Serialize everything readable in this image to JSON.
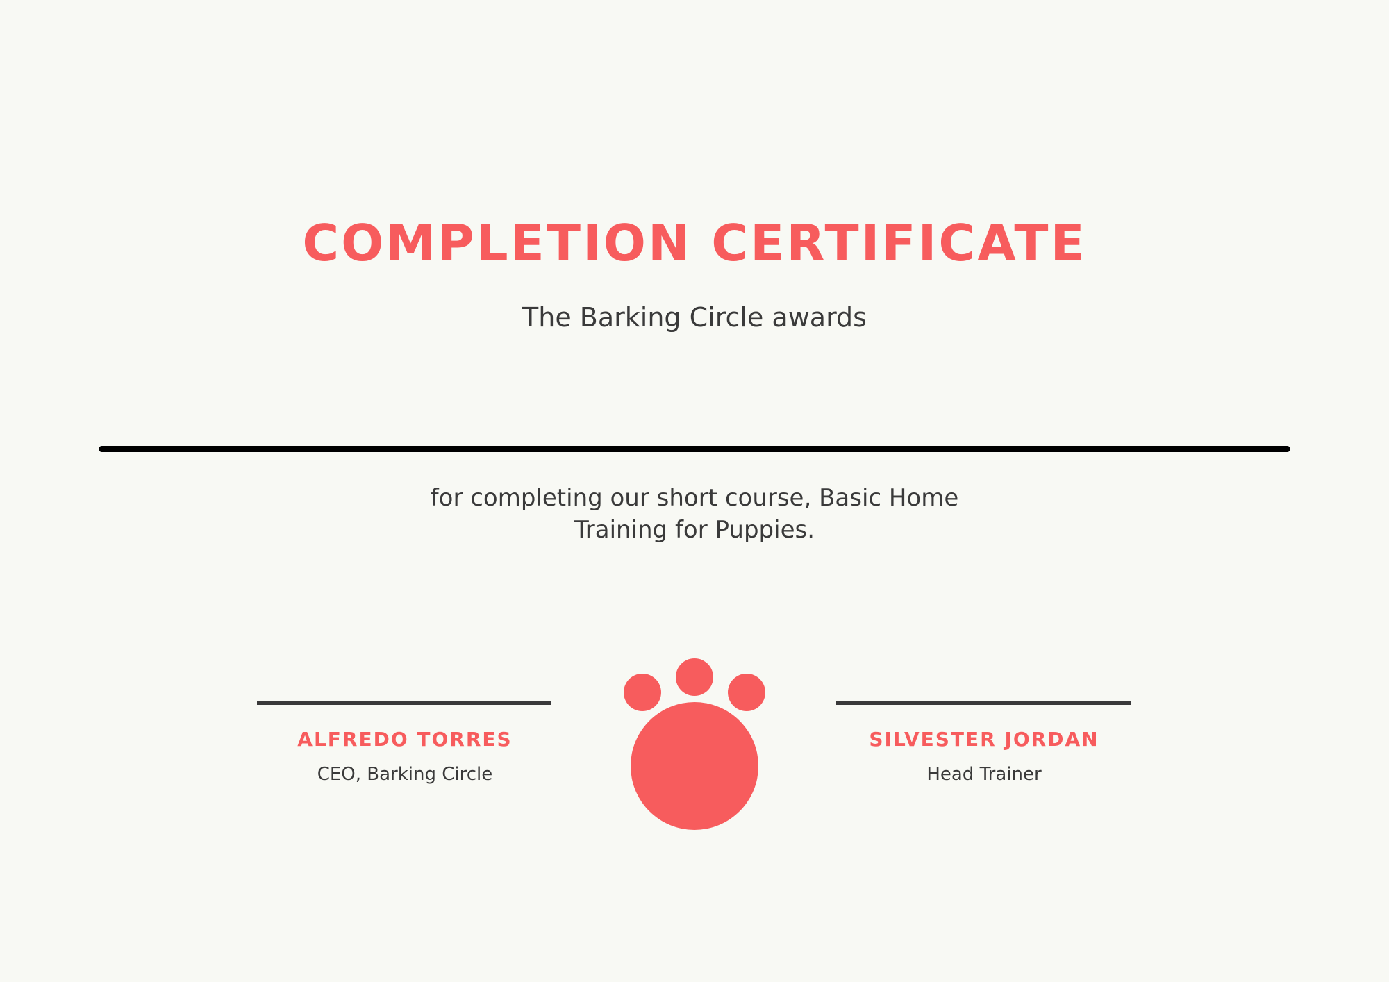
{
  "certificate": {
    "title": "COMPLETION CERTIFICATE",
    "subtitle": "The Barking Circle awards",
    "reason_line1": "for completing our short course, Basic Home",
    "reason_line2": "Training for Puppies."
  },
  "signatories": [
    {
      "name": "ALFREDO TORRES",
      "role": "CEO, Barking Circle"
    },
    {
      "name": "SILVESTER JORDAN",
      "role": "Head Trainer"
    }
  ],
  "emblem": {
    "icon": "paw-print-icon",
    "color": "#f75c5d"
  },
  "colors": {
    "accent": "#f75c5d",
    "text": "#3a3a3a",
    "background": "#f8f9f4"
  }
}
